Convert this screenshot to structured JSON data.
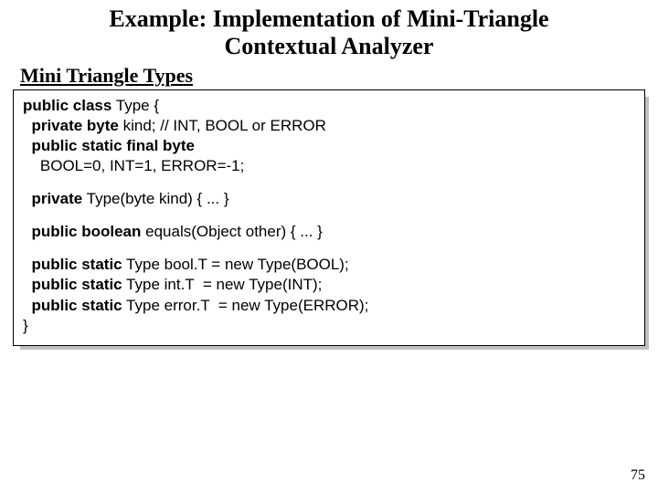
{
  "title_line1": "Example: Implementation of Mini-Triangle",
  "title_line2": "Contextual Analyzer",
  "section_heading": "Mini Triangle Types",
  "code": {
    "l1a": "public class",
    "l1b": " Type {",
    "l2a": "  private byte",
    "l2b": " kind; // INT, BOOL or ERROR",
    "l3a": "  public static final byte",
    "l4": "    BOOL=0, INT=1, ERROR=-1;",
    "l5a": "  private",
    "l5b": " Type(byte kind) { ... }",
    "l6a": "  public boolean",
    "l6b": " equals(Object other) { ... }",
    "l7a": "  public static",
    "l7b": " Type bool.T = new Type(BOOL);",
    "l8a": "  public static",
    "l8b": " Type int.T  = new Type(INT);",
    "l9a": "  public static",
    "l9b": " Type error.T  = new Type(ERROR);",
    "l10": "}"
  },
  "page_number": "75"
}
